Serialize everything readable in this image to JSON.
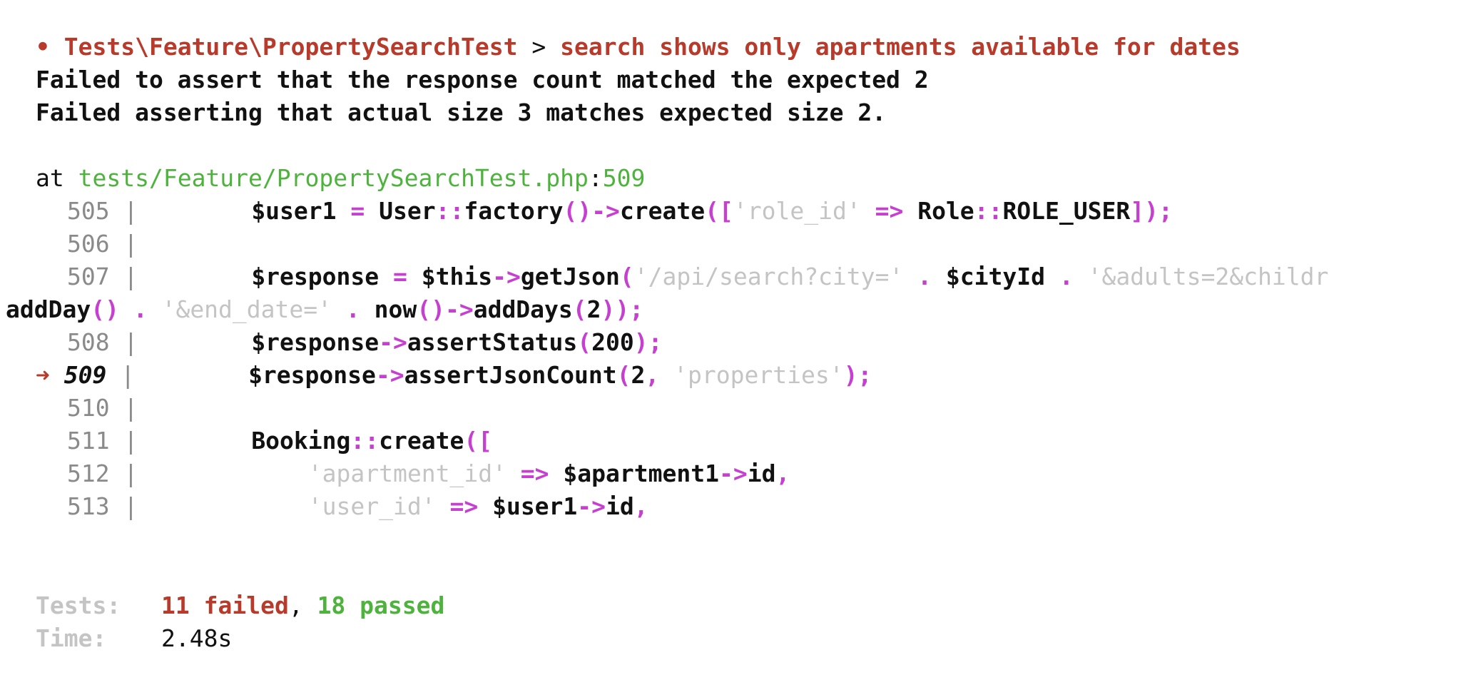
{
  "failure": {
    "bullet": "•",
    "test_class": "Tests\\Feature\\PropertySearchTest",
    "separator": ">",
    "test_name": "search shows only apartments available for dates",
    "message_1": "Failed to assert that the response count matched the expected 2",
    "message_2": "Failed asserting that actual size 3 matches expected size 2."
  },
  "location": {
    "prefix": "at",
    "file": "tests/Feature/PropertySearchTest.php",
    "colon": ":",
    "line": "509"
  },
  "code": {
    "arrow": "➜",
    "pipe": "|",
    "l505": {
      "num": "505",
      "user1": "$user1",
      "eq": " = ",
      "User": "User",
      "dc": "::",
      "factory": "factory",
      "p1": "()->",
      "create": "create",
      "o": "([",
      "s": "'role_id'",
      "fa": " => ",
      "Role": "Role",
      "dc2": "::",
      "const": "ROLE_USER",
      "c": "]);"
    },
    "l506": {
      "num": "506"
    },
    "l507": {
      "num": "507",
      "resp": "$response",
      "eq": " = ",
      "this": "$this",
      "ar": "->",
      "fn": "getJson",
      "o": "(",
      "s1": "'/api/search?city='",
      "dot1": " . ",
      "cityId": "$cityId",
      "dot2": " . ",
      "s2": "'&adults=2&childr"
    },
    "wrap": {
      "fn": "addDay",
      "p": "()",
      "dot1": " . ",
      "s": "'&end_date='",
      "dot2": " . ",
      "now": "now",
      "p2": "()->",
      "fn2": "addDays",
      "o": "(",
      "n": "2",
      "c": "));"
    },
    "l508": {
      "num": "508",
      "resp": "$response",
      "ar": "->",
      "fn": "assertStatus",
      "o": "(",
      "n": "200",
      "c": ");"
    },
    "l509": {
      "num": "509",
      "resp": "$response",
      "ar": "->",
      "fn": "assertJsonCount",
      "o": "(",
      "n": "2",
      "comma": ", ",
      "s": "'properties'",
      "c": ");"
    },
    "l510": {
      "num": "510"
    },
    "l511": {
      "num": "511",
      "cls": "Booking",
      "dc": "::",
      "fn": "create",
      "o": "(["
    },
    "l512": {
      "num": "512",
      "s": "'apartment_id'",
      "fa": " => ",
      "var": "$apartment1",
      "ar": "->",
      "prop": "id",
      "comma": ","
    },
    "l513": {
      "num": "513",
      "s": "'user_id'",
      "fa": " => ",
      "var": "$user1",
      "ar": "->",
      "prop": "id",
      "comma": ","
    }
  },
  "summary": {
    "tests_label": "Tests:",
    "failed": "11 failed",
    "comma": ",",
    "passed": "18 passed",
    "time_label": "Time:",
    "time": "2.48s"
  }
}
